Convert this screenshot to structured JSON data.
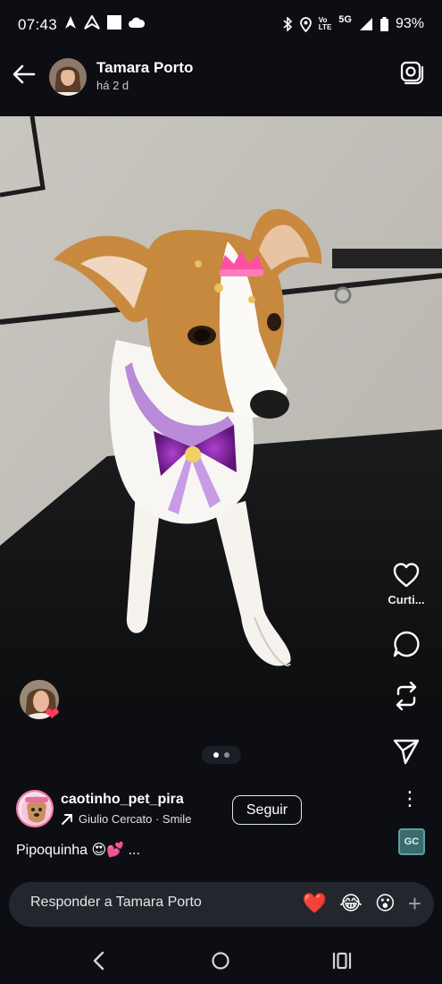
{
  "status_bar": {
    "time": "07:43",
    "battery": "93%",
    "network": "5G",
    "volte_top": "Vo",
    "volte_bottom": "LTE"
  },
  "header": {
    "user_name": "Tamara Porto",
    "timestamp": "há 2 d"
  },
  "actions": {
    "like_label": "Curti..."
  },
  "carousel": {
    "total": 2,
    "active": 0
  },
  "author": {
    "handle": "caotinho_pet_pira",
    "music": "Giulio Cercato · Smile",
    "follow_label": "Seguir",
    "caption": "Pipoquinha 😍💕 ..."
  },
  "badge": {
    "text": "GC"
  },
  "reply": {
    "placeholder": "Responder a Tamara Porto",
    "emoji_1": "❤️",
    "emoji_2": "😂",
    "emoji_3": "😮",
    "plus": "+"
  },
  "colors": {
    "background": "#0c0e13",
    "reply_bar": "#23262d",
    "heart_badge": "#ff3b5a"
  }
}
